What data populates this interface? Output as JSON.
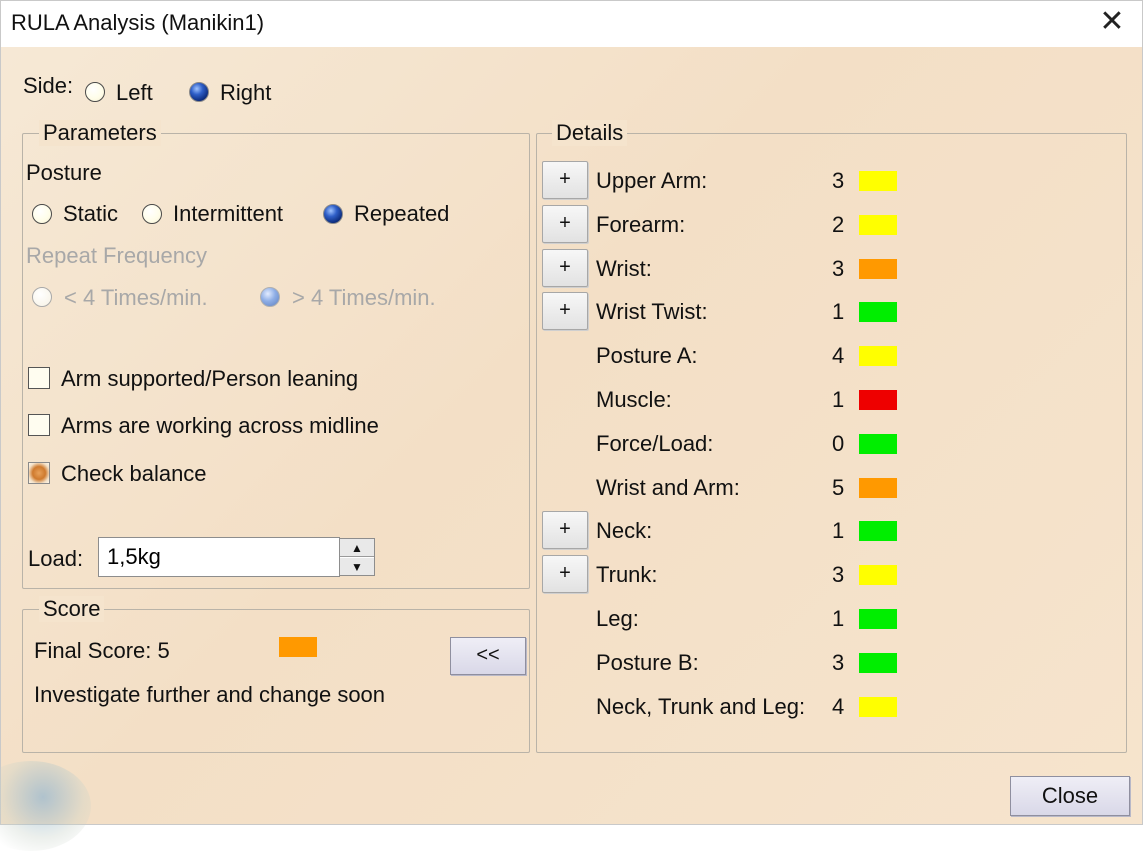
{
  "window": {
    "title": "RULA Analysis (Manikin1)",
    "close_glyph": "✕"
  },
  "side": {
    "label": "Side:",
    "options": [
      "Left",
      "Right"
    ],
    "selected": "Right"
  },
  "parameters": {
    "title": "Parameters",
    "posture_label": "Posture",
    "posture_options": [
      "Static",
      "Intermittent",
      "Repeated"
    ],
    "posture_selected": "Repeated",
    "repeat_frequency_label": "Repeat Frequency",
    "frequency_options": [
      "< 4 Times/min.",
      "> 4 Times/min."
    ],
    "frequency_selected": "> 4 Times/min.",
    "checkboxes": [
      {
        "label": "Arm supported/Person leaning",
        "checked": false
      },
      {
        "label": "Arms are working across midline",
        "checked": false
      },
      {
        "label": "Check balance",
        "checked": true
      }
    ],
    "load_label": "Load:",
    "load_value": "1,5kg"
  },
  "score": {
    "title": "Score",
    "final_score_text": "Final Score: 5",
    "final_color": "#ff9900",
    "message": "Investigate further and change soon",
    "collapse_label": "<<"
  },
  "details": {
    "title": "Details",
    "expand_label": "+",
    "rows": [
      {
        "label": "Upper Arm:",
        "value": "3",
        "color": "#ffff00",
        "expandable": true
      },
      {
        "label": "Forearm:",
        "value": "2",
        "color": "#ffff00",
        "expandable": true
      },
      {
        "label": "Wrist:",
        "value": "3",
        "color": "#ff9900",
        "expandable": true
      },
      {
        "label": "Wrist Twist:",
        "value": "1",
        "color": "#00ee00",
        "expandable": true
      },
      {
        "label": "Posture A:",
        "value": "4",
        "color": "#ffff00",
        "expandable": false
      },
      {
        "label": "Muscle:",
        "value": "1",
        "color": "#ee0000",
        "expandable": false
      },
      {
        "label": "Force/Load:",
        "value": "0",
        "color": "#00ee00",
        "expandable": false
      },
      {
        "label": "Wrist and Arm:",
        "value": "5",
        "color": "#ff9900",
        "expandable": false
      },
      {
        "label": "Neck:",
        "value": "1",
        "color": "#00ee00",
        "expandable": true
      },
      {
        "label": "Trunk:",
        "value": "3",
        "color": "#ffff00",
        "expandable": true
      },
      {
        "label": "Leg:",
        "value": "1",
        "color": "#00ee00",
        "expandable": false
      },
      {
        "label": "Posture B:",
        "value": "3",
        "color": "#00ee00",
        "expandable": false
      },
      {
        "label": "Neck, Trunk and Leg:",
        "value": "4",
        "color": "#ffff00",
        "expandable": false
      }
    ]
  },
  "footer": {
    "close_label": "Close"
  }
}
